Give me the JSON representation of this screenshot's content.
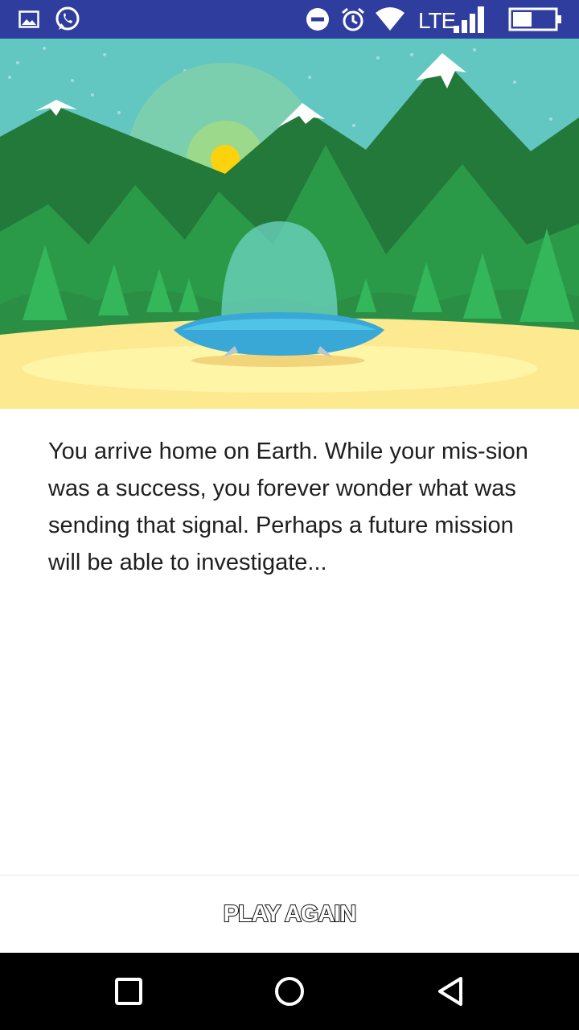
{
  "status_bar": {
    "icons": [
      "gallery-icon",
      "whatsapp-icon",
      "do-not-disturb-icon",
      "alarm-icon",
      "wifi-icon",
      "signal-icon",
      "battery-icon"
    ],
    "network_label": "LTE",
    "battery_level": 0.45,
    "background_color": "#2f3e9e"
  },
  "scene": {
    "sky_color": "#62c6c1",
    "mountain_color": "#22793a",
    "forest_color": "#2b9a48",
    "tree_color": "#34b65a",
    "sand_color": "#fde98f",
    "sun_color": "#fcd20d",
    "ufo_color": "#3aa8d6"
  },
  "story": {
    "text": "You arrive home on Earth. While your mis-sion was a success, you forever wonder what was sending that signal. Perhaps a future mission will be able to investigate..."
  },
  "actions": {
    "play_again_label": "PLAY AGAIN"
  },
  "nav_bar": {
    "icons": [
      "recent-apps-icon",
      "home-icon",
      "back-icon"
    ]
  }
}
